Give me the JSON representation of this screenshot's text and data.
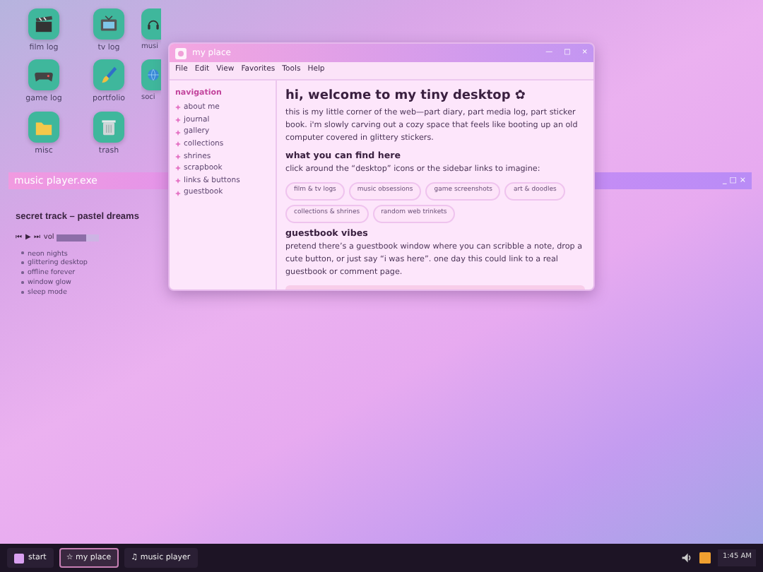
{
  "desktop_icons": [
    {
      "label": "film log",
      "kind": "film"
    },
    {
      "label": "tv log",
      "kind": "tv"
    },
    {
      "label": "musi",
      "kind": "headphones"
    },
    {
      "label": "game log",
      "kind": "gamepad"
    },
    {
      "label": "portfolio",
      "kind": "brush"
    },
    {
      "label": "soci",
      "kind": "globe"
    },
    {
      "label": "misc",
      "kind": "folder"
    },
    {
      "label": "trash",
      "kind": "trash"
    }
  ],
  "music_player": {
    "title": "music player.exe",
    "window_controls": [
      "_",
      "□",
      "×"
    ],
    "track": "secret track – pastel dreams",
    "controls": [
      "⏮",
      "▶",
      "⏭"
    ],
    "volume_label": "vol",
    "volume": {
      "level": 0.7
    },
    "playlist": [
      "neon nights",
      "glittering desktop",
      "offline forever",
      "window glow",
      "sleep mode"
    ]
  },
  "window": {
    "title": "my place",
    "controls": [
      "—",
      "□",
      "×"
    ],
    "menu": [
      "File",
      "Edit",
      "View",
      "Favorites",
      "Tools",
      "Help"
    ],
    "sidebar": {
      "heading": "navigation",
      "items": [
        "about me",
        "journal",
        "gallery",
        "collections",
        "shrines",
        "scrapbook",
        "links & buttons",
        "guestbook"
      ]
    },
    "content": {
      "heading": "hi, welcome to my tiny desktop ✿",
      "intro": "this is my little corner of the web—part diary, part media log, part sticker book. i'm slowly carving out a cozy space that feels like booting up an old computer covered in glittery stickers.",
      "sections": [
        {
          "heading": "what you can find here",
          "text": "click around the “desktop” icons or the sidebar links to imagine:",
          "tags": [
            "film & tv logs",
            "music obsessions",
            "game screenshots",
            "art & doodles",
            "collections & shrines",
            "random web trinkets"
          ]
        },
        {
          "heading": "guestbook vibes",
          "text": "pretend there’s a guestbook window where you can scribble a note, drop a cute button, or just say “i was here”. one day this could link to a real guestbook or comment page."
        }
      ]
    }
  },
  "taskbar": {
    "start": "start",
    "tasks": [
      {
        "label": "my place",
        "icon": "☆",
        "selected": true
      },
      {
        "label": "music player",
        "icon": "♫",
        "selected": false
      }
    ],
    "clock": "1:45 AM"
  }
}
